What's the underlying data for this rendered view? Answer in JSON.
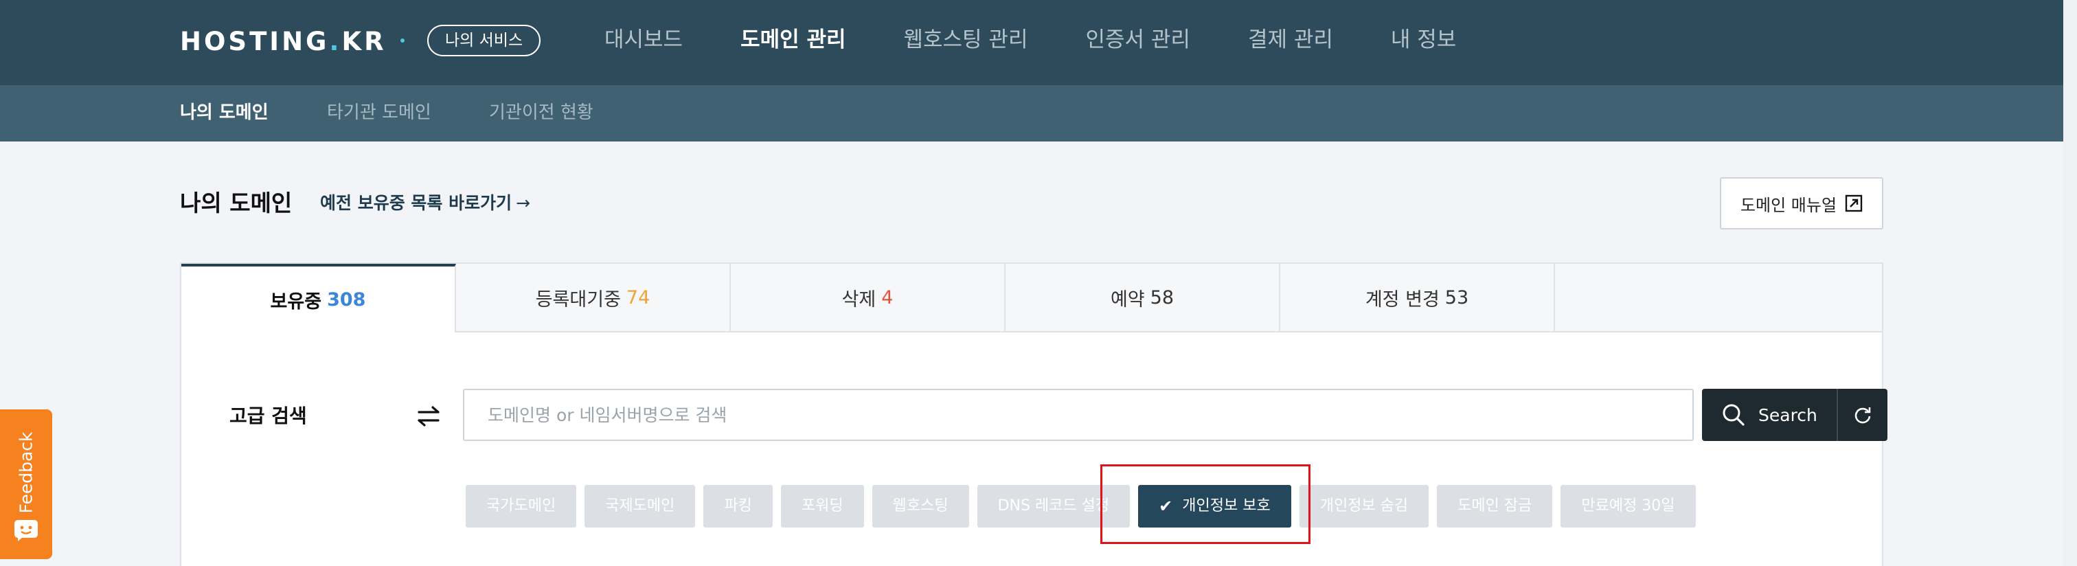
{
  "header": {
    "logo": "HOSTING.KR",
    "logo_main": "HOSTING",
    "logo_dot": ".",
    "logo_tld": "KR",
    "my_service": "나의 서비스",
    "nav": [
      "대시보드",
      "도메인 관리",
      "웹호스팅 관리",
      "인증서 관리",
      "결제 관리",
      "내 정보"
    ],
    "active_nav": "도메인 관리"
  },
  "subnav": {
    "items": [
      "나의 도메인",
      "타기관 도메인",
      "기관이전 현황"
    ],
    "active": "나의 도메인"
  },
  "page": {
    "title": "나의 도메인",
    "old_list_link": "예전 보유중 목록 바로가기",
    "old_list_arrow": "→",
    "manual_button": "도메인 매뉴얼"
  },
  "tabs": [
    {
      "label": "보유중",
      "count": "308",
      "count_color": "#3b86d6"
    },
    {
      "label": "등록대기중",
      "count": "74",
      "count_color": "#f2a23a"
    },
    {
      "label": "삭제",
      "count": "4",
      "count_color": "#e2533f"
    },
    {
      "label": "예약",
      "count": "58",
      "count_color": "#333333"
    },
    {
      "label": "계정 변경",
      "count": "53",
      "count_color": "#333333"
    }
  ],
  "search": {
    "label": "고급 검색",
    "placeholder": "도메인명 or 네임서버명으로 검색",
    "value": "",
    "button": "Search"
  },
  "filters": [
    {
      "label": "국가도메인",
      "selected": false
    },
    {
      "label": "국제도메인",
      "selected": false
    },
    {
      "label": "파킹",
      "selected": false
    },
    {
      "label": "포워딩",
      "selected": false
    },
    {
      "label": "웹호스팅",
      "selected": false
    },
    {
      "label": "DNS 레코드 설정",
      "selected": false
    },
    {
      "label": "개인정보 보호",
      "selected": true
    },
    {
      "label": "개인정보 숨김",
      "selected": false
    },
    {
      "label": "도메인 잠금",
      "selected": false
    },
    {
      "label": "만료예정 30일",
      "selected": false
    }
  ],
  "feedback": {
    "label": "Feedback"
  },
  "colors": {
    "topnav": "#2e4b5b",
    "subnav": "#3f6172",
    "active_filter": "#24475c",
    "feedback": "#f5821f",
    "highlight": "#e0121a"
  }
}
